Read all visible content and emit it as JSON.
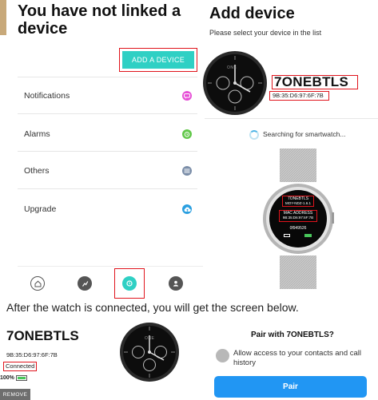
{
  "left_phone": {
    "title": "You have not linked a device",
    "add_button": "ADD A DEVICE",
    "menu": [
      {
        "label": "Notifications",
        "icon": "chat-bubble-icon",
        "color": "#e64fd6"
      },
      {
        "label": "Alarms",
        "icon": "alarm-clock-icon",
        "color": "#62c84a"
      },
      {
        "label": "Others",
        "icon": "more-icon",
        "color": "#7a8da8"
      },
      {
        "label": "Upgrade",
        "icon": "cloud-upload-icon",
        "color": "#2a9fe0"
      }
    ],
    "tabs": [
      "home-icon",
      "activity-icon",
      "watch-icon",
      "profile-icon"
    ],
    "active_tab": "watch-icon"
  },
  "right_phone": {
    "title": "Add device",
    "subtitle": "Please select your device in the list",
    "device_name": "7ONEBTLS",
    "device_mac": "9B:35:D6:97:6F:7B",
    "searching": "Searching for smartwatch...",
    "watch_face_brand": "ONE",
    "watch_screen": {
      "model": "7ONEBTLS",
      "model_sub": "MOY-NDZ-1.6.1",
      "mac_label": "MAC ADDRESS",
      "mac": "9B:35:D6:97:6F:7B",
      "code": "0f949526"
    }
  },
  "caption": "After the watch is connected, you will get the screen below.",
  "connected_device": {
    "name": "7ONEBTLS",
    "mac": "9B:35:D6:97:6F:7B",
    "status": "Connected",
    "battery": "100%",
    "battery_level": 1.0,
    "remove_button": "REMOVE",
    "watch_face_brand": "ONE"
  },
  "pair_dialog": {
    "title": "Pair with 7ONEBTLS?",
    "allow_text": "Allow access to your contacts and call history",
    "pair_button": "Pair"
  },
  "colors": {
    "accent_teal": "#2fd0c4",
    "highlight_red": "#e0141c",
    "pair_blue": "#2196f3"
  }
}
